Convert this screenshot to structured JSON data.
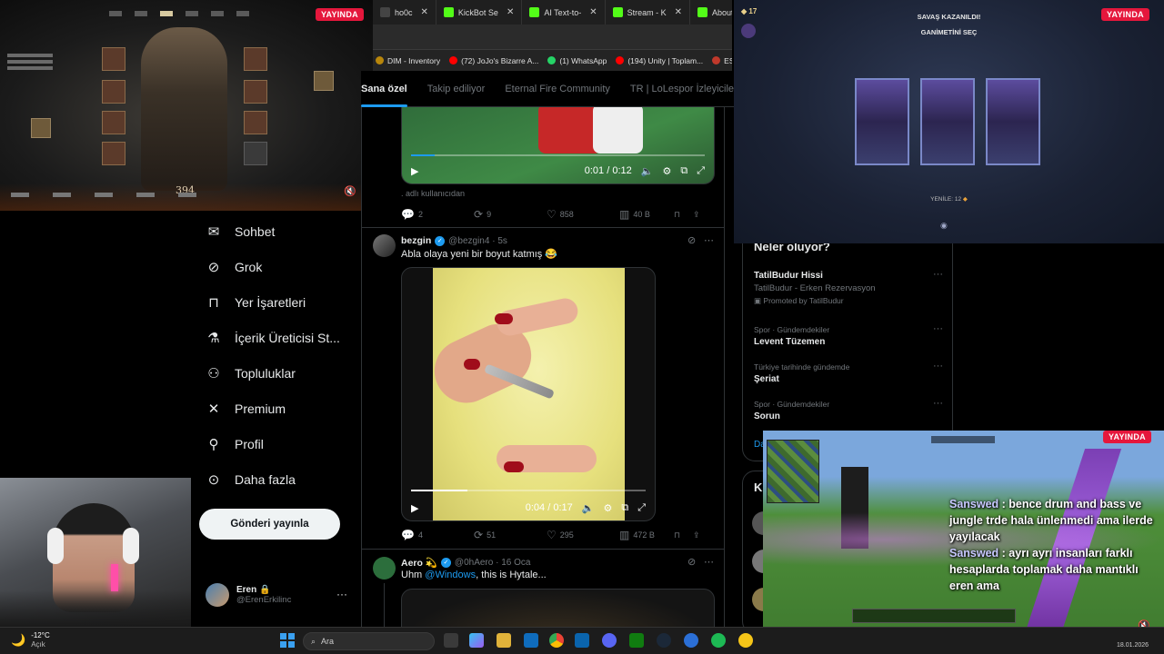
{
  "browser": {
    "tabs": [
      {
        "label": "ho0c",
        "color": "#444"
      },
      {
        "label": "KickBot Se",
        "color": "#53fc18"
      },
      {
        "label": "AI Text-to-",
        "color": "#53fc18"
      },
      {
        "label": "Stream - K",
        "color": "#53fc18"
      },
      {
        "label": "About San",
        "color": "#53fc18"
      }
    ],
    "tab_close": "✕",
    "bookmarks": [
      {
        "label": "DIM - Inventory",
        "color": "#b8860b"
      },
      {
        "label": "(72) JoJo's Bizarre A...",
        "color": "#ff0000"
      },
      {
        "label": "(1) WhatsApp",
        "color": "#25d366"
      },
      {
        "label": "(194) Unity | Toplam...",
        "color": "#ff0000"
      },
      {
        "label": "ESO",
        "color": "#c0392b"
      }
    ]
  },
  "feed_tabs": [
    "Sana özel",
    "Takip ediliyor",
    "Eternal Fire Community",
    "TR | LoLespor İzleyicile"
  ],
  "tweet1": {
    "time": "0:01 / 0:12",
    "caption": ". adlı kullanıcıdan",
    "replies": "2",
    "retweets": "9",
    "likes": "858",
    "views": "40 B"
  },
  "tweet2": {
    "name": "bezgin",
    "handle": "@bezgin4 · 5s",
    "text": "Abla olaya yeni bir boyut katmış 😂",
    "time": "0:04 / 0:17",
    "replies": "4",
    "retweets": "51",
    "likes": "295",
    "views": "472 B"
  },
  "tweet3": {
    "name": "Aero 💫",
    "handle": "@0hAero · 16 Oca",
    "text_prefix": "Uhm ",
    "mention": "@Windows",
    "text_suffix": ", this is Hytale..."
  },
  "nav": {
    "items": [
      {
        "label": "Sohbet",
        "icon": "✉"
      },
      {
        "label": "Grok",
        "icon": "⊘"
      },
      {
        "label": "Yer İşaretleri",
        "icon": "🔖"
      },
      {
        "label": "İçerik Üreticisi St...",
        "icon": "⚗"
      },
      {
        "label": "Topluluklar",
        "icon": "👥"
      },
      {
        "label": "Premium",
        "icon": "𝕏"
      },
      {
        "label": "Profil",
        "icon": "👤"
      },
      {
        "label": "Daha fazla",
        "icon": "⋯"
      }
    ],
    "post_button": "Gönderi yayınla",
    "account_name": "Eren 🔒",
    "account_handle": "@ErenErkilinc",
    "more": "···"
  },
  "trends": {
    "header": "Neler oluyor?",
    "promo": {
      "title": "TatilBudur Hissi",
      "subtitle": "TatilBudur - Erken Rezervasyon",
      "promoted": "Promoted by TatilBudur"
    },
    "items": [
      {
        "meta": "Spor · Gündemdekiler",
        "title": "Levent Tüzemen"
      },
      {
        "meta": "Türkiye tarihinde gündemde",
        "title": "Şeriat"
      },
      {
        "meta": "Spor · Gündemdekiler",
        "title": "Sorun"
      }
    ],
    "show_more": "Da",
    "next_header": "K"
  },
  "overlays": {
    "live_label": "YAYINDA",
    "game1": {
      "level": "394"
    },
    "game2": {
      "title": "SAVAŞ KAZANILDI!",
      "subtitle": "GANİMETİNİ SEÇ",
      "reroll": "YENİLE: 12",
      "coins": "17"
    },
    "game3": {
      "chat": [
        {
          "user": "Sanswed",
          "message": "bence drum and bass ve jungle trde hala ünlenmedi ama ilerde yayılacak"
        },
        {
          "user": "Sanswed",
          "message": "ayrı ayrı insanları farklı hesaplarda toplamak daha mantıklı eren ama"
        }
      ]
    }
  },
  "taskbar": {
    "temp": "-12°C",
    "condition": "Açık",
    "search_placeholder": "Ara",
    "date": "18.01.2026"
  }
}
